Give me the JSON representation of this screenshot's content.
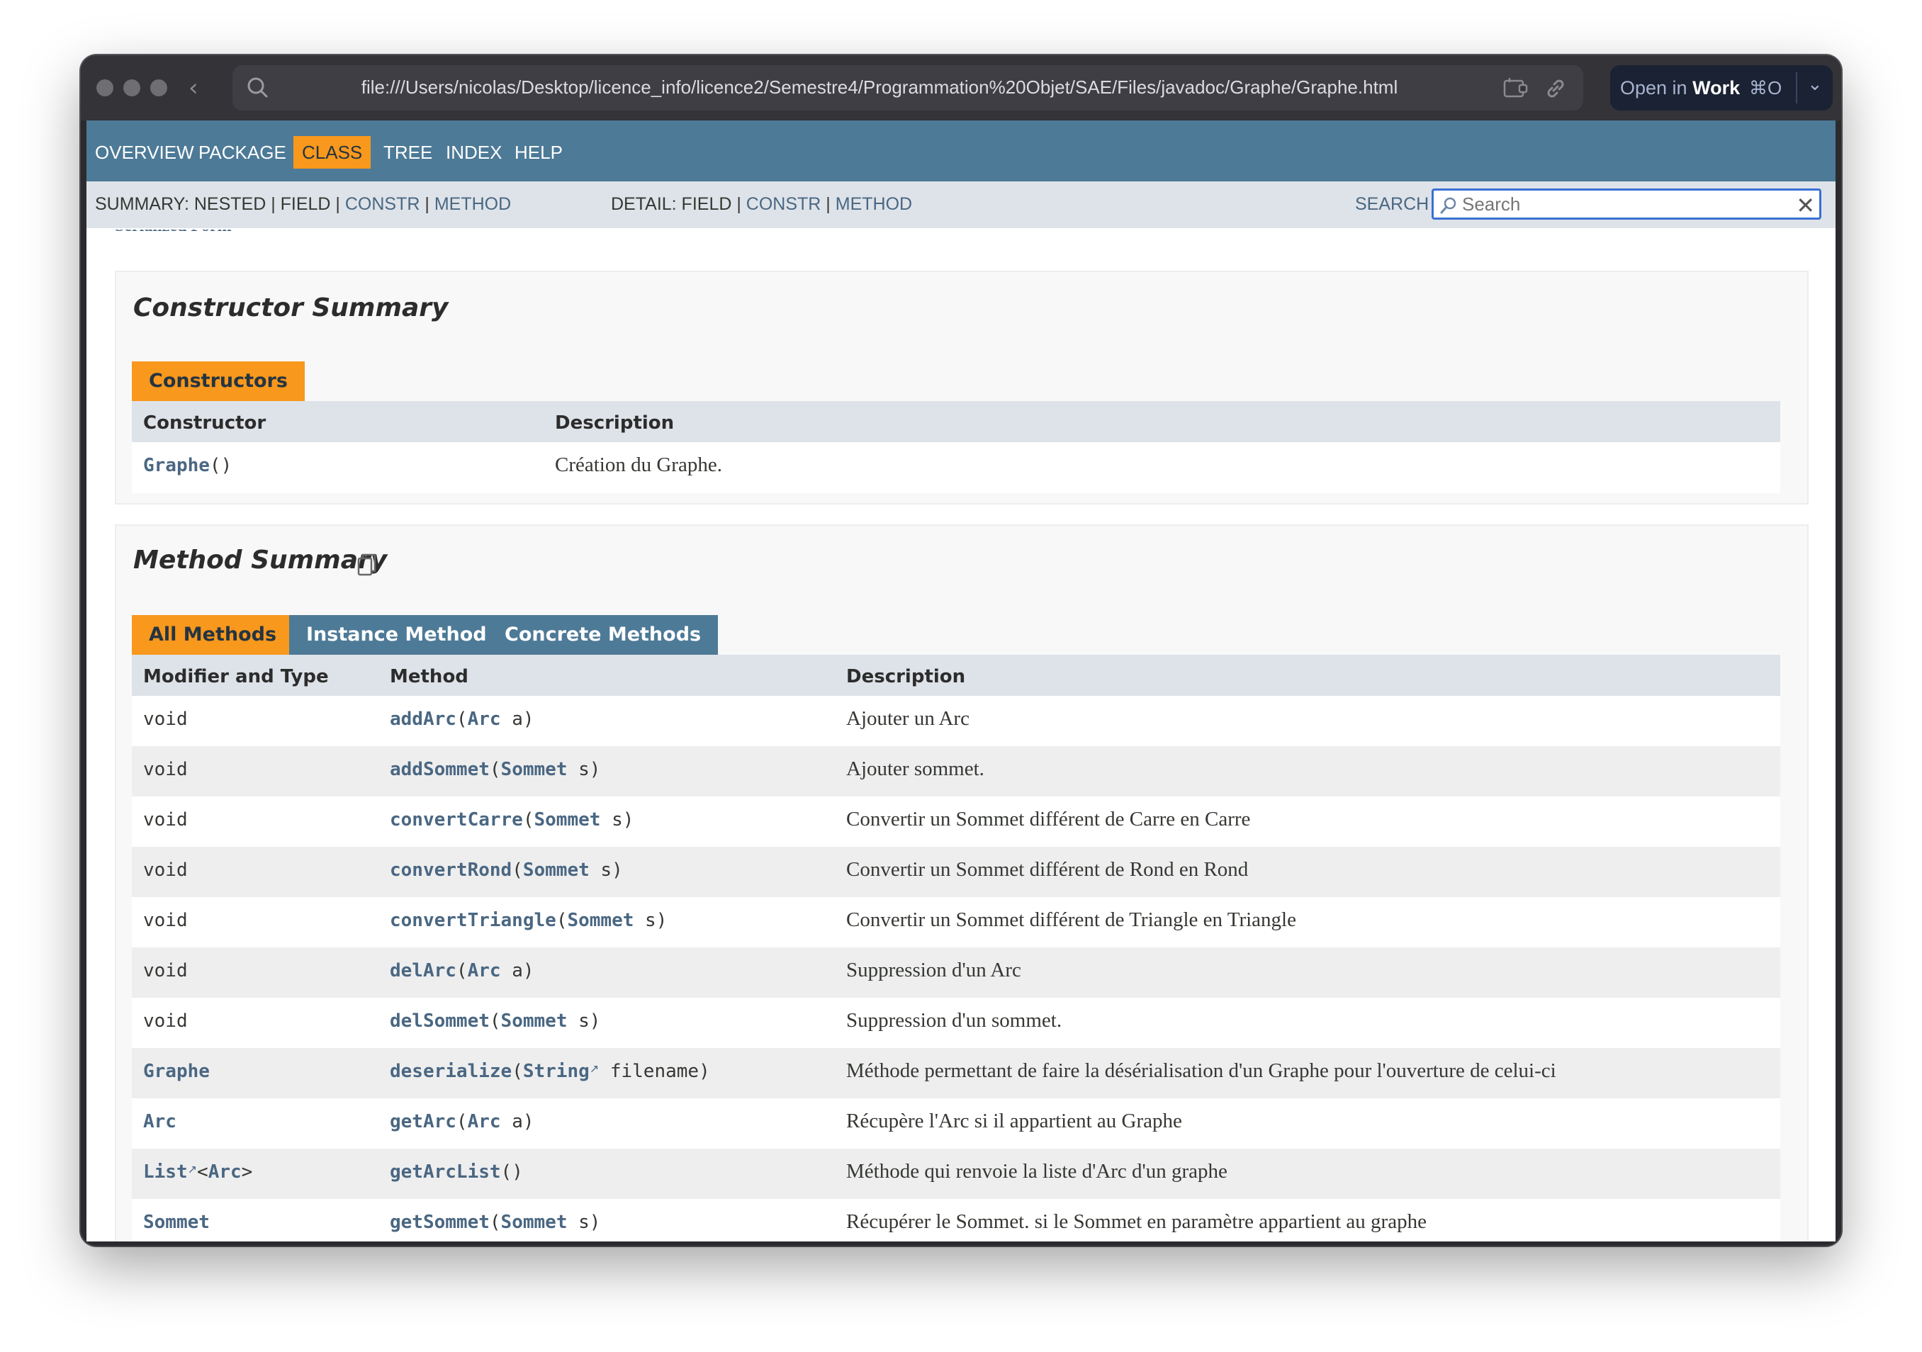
{
  "browser": {
    "url": "file:///Users/nicolas/Desktop/licence_info/licence2/Semestre4/Programmation%20Objet/SAE/Files/javadoc/Graphe/Graphe.html",
    "open_in_prefix": "Open in",
    "open_in_target": "Work",
    "open_in_shortcut": "⌘O"
  },
  "nav": {
    "items": [
      "OVERVIEW",
      "PACKAGE",
      "CLASS",
      "TREE",
      "INDEX",
      "HELP"
    ],
    "active": "CLASS"
  },
  "subnav": {
    "summary_prefix": "SUMMARY: NESTED | FIELD | ",
    "summary_constr": "CONSTR",
    "summary_method": "METHOD",
    "detail_prefix": "DETAIL: FIELD | ",
    "detail_constr": "CONSTR",
    "detail_method": "METHOD",
    "sep": " | ",
    "search_label": "SEARCH",
    "search_placeholder": "Search"
  },
  "scrolled_text": "Serialized Form",
  "constructor_summary": {
    "title": "Constructor Summary",
    "tab": "Constructors",
    "headers": [
      "Constructor",
      "Description"
    ],
    "rows": [
      {
        "name": "Graphe",
        "args": "()",
        "description": "Création du Graphe."
      }
    ]
  },
  "method_summary": {
    "title": "Method Summary",
    "tabs": [
      "All Methods",
      "Instance Methods",
      "Concrete Methods"
    ],
    "headers": [
      "Modifier and Type",
      "Method",
      "Description"
    ],
    "rows": [
      {
        "type": "void",
        "type_link": false,
        "type_generic": "",
        "name": "addArc",
        "param_type": "Arc",
        "param_ext": false,
        "param_name": "a",
        "description": "Ajouter un Arc"
      },
      {
        "type": "void",
        "type_link": false,
        "type_generic": "",
        "name": "addSommet",
        "param_type": "Sommet",
        "param_ext": false,
        "param_name": "s",
        "description": "Ajouter sommet."
      },
      {
        "type": "void",
        "type_link": false,
        "type_generic": "",
        "name": "convertCarre",
        "param_type": "Sommet",
        "param_ext": false,
        "param_name": "s",
        "description": "Convertir un Sommet différent de Carre en Carre"
      },
      {
        "type": "void",
        "type_link": false,
        "type_generic": "",
        "name": "convertRond",
        "param_type": "Sommet",
        "param_ext": false,
        "param_name": "s",
        "description": "Convertir un Sommet différent de Rond en Rond"
      },
      {
        "type": "void",
        "type_link": false,
        "type_generic": "",
        "name": "convertTriangle",
        "param_type": "Sommet",
        "param_ext": false,
        "param_name": "s",
        "description": "Convertir un Sommet différent de Triangle en Triangle"
      },
      {
        "type": "void",
        "type_link": false,
        "type_generic": "",
        "name": "delArc",
        "param_type": "Arc",
        "param_ext": false,
        "param_name": "a",
        "description": "Suppression d'un Arc"
      },
      {
        "type": "void",
        "type_link": false,
        "type_generic": "",
        "name": "delSommet",
        "param_type": "Sommet",
        "param_ext": false,
        "param_name": "s",
        "description": "Suppression d'un sommet."
      },
      {
        "type": "Graphe",
        "type_link": true,
        "type_generic": "",
        "name": "deserialize",
        "param_type": "String",
        "param_ext": true,
        "param_name": "filename",
        "description": "Méthode permettant de faire la désérialisation d'un Graphe pour l'ouverture de celui-ci"
      },
      {
        "type": "Arc",
        "type_link": true,
        "type_generic": "",
        "name": "getArc",
        "param_type": "Arc",
        "param_ext": false,
        "param_name": "a",
        "description": "Récupère l'Arc si il appartient au Graphe"
      },
      {
        "type": "List",
        "type_link": true,
        "type_generic": "Arc",
        "name": "getArcList",
        "param_type": "",
        "param_ext": false,
        "param_name": "",
        "description": "Méthode qui renvoie la liste d'Arc d'un graphe"
      },
      {
        "type": "Sommet",
        "type_link": true,
        "type_generic": "",
        "name": "getSommet",
        "param_type": "Sommet",
        "param_ext": false,
        "param_name": "s",
        "description": "Récupérer le Sommet. si le Sommet en paramètre appartient au graphe"
      }
    ]
  },
  "colors": {
    "nav_bg": "#4d7a97",
    "accent": "#f8981d",
    "subnav_bg": "#dee3e9",
    "link": "#4a6782"
  }
}
